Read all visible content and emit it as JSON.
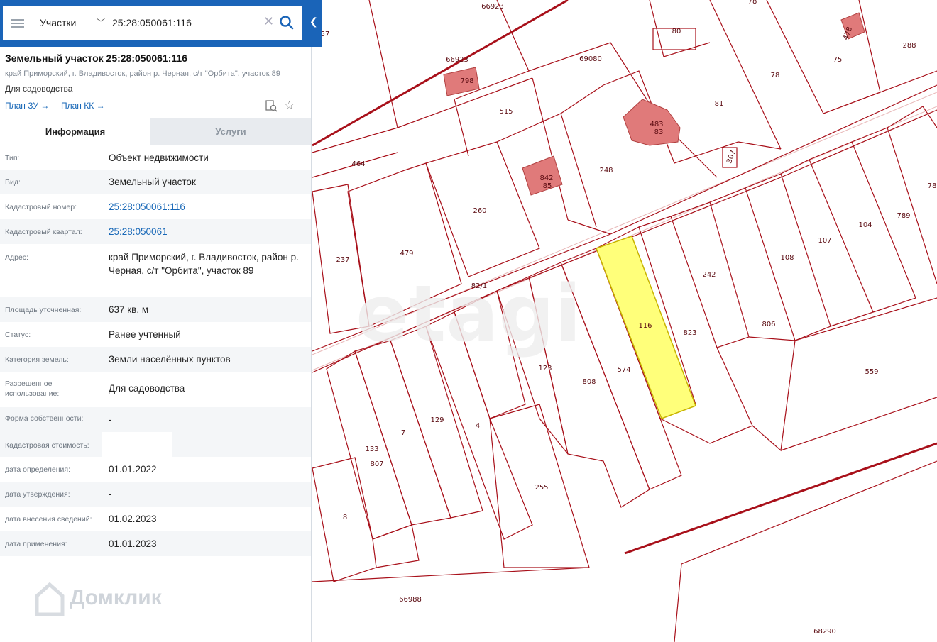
{
  "search": {
    "type": "Участки",
    "value": "25:28:050061:116"
  },
  "parcel": {
    "title": "Земельный участок 25:28:050061:116",
    "address_line": "край Приморский, г. Владивосток, район р. Черная, с/т \"Орбита\", участок 89",
    "purpose": "Для садоводства",
    "links": [
      "План ЗУ →",
      "План КК →"
    ]
  },
  "tabs": [
    "Информация",
    "Услуги"
  ],
  "info_rows": [
    {
      "label": "Тип:",
      "value": "Объект недвижимости"
    },
    {
      "label": "Вид:",
      "value": "Земельный участок"
    },
    {
      "label": "Кадастровый номер:",
      "value": "25:28:050061:116"
    },
    {
      "label": "Кадастровый квартал:",
      "value": "25:28:050061"
    },
    {
      "label": "Адрес:",
      "value": "край Приморский, г. Владивосток, район р. Черная, с/т \"Орбита\", участок 89"
    },
    {
      "label": "Площадь уточненная:",
      "value": "637 кв. м"
    },
    {
      "label": "Статус:",
      "value": "Ранее учтенный"
    },
    {
      "label": "Категория земель:",
      "value": "Земли населённых пунктов"
    },
    {
      "label": "Разрешенное использование:",
      "value": "Для садоводства"
    },
    {
      "label": "Форма собственности:",
      "value": "-"
    },
    {
      "label": "Кадастровая стоимость:",
      "value": ""
    },
    {
      "label": "дата определения:",
      "value": "01.01.2022"
    },
    {
      "label": "дата утверждения:",
      "value": "-"
    },
    {
      "label": "дата внесения сведений:",
      "value": "01.02.2023"
    },
    {
      "label": "дата применения:",
      "value": "01.01.2023"
    }
  ],
  "map": {
    "selected_parcel": "116",
    "parcel_labels": [
      "66923",
      "57",
      "78",
      "80",
      "478",
      "288",
      "66923",
      "798",
      "69080",
      "75",
      "78",
      "515",
      "81",
      "483",
      "83",
      "464",
      "842",
      "85",
      "248",
      "307",
      "78",
      "260",
      "237",
      "479",
      "82/1",
      "104",
      "789",
      "107",
      "108",
      "242",
      "116",
      "823",
      "806",
      "123",
      "808",
      "574",
      "559",
      "129",
      "7",
      "4",
      "133",
      "807",
      "255",
      "8",
      "66988",
      "68290"
    ],
    "watermark_center": "etagi",
    "colors": {
      "boundary": "#a8101a",
      "selected_fill": "#ffff7a",
      "building_fill": "#e07a7a",
      "road": "#e8b8b8"
    }
  },
  "watermark": "Домклик"
}
